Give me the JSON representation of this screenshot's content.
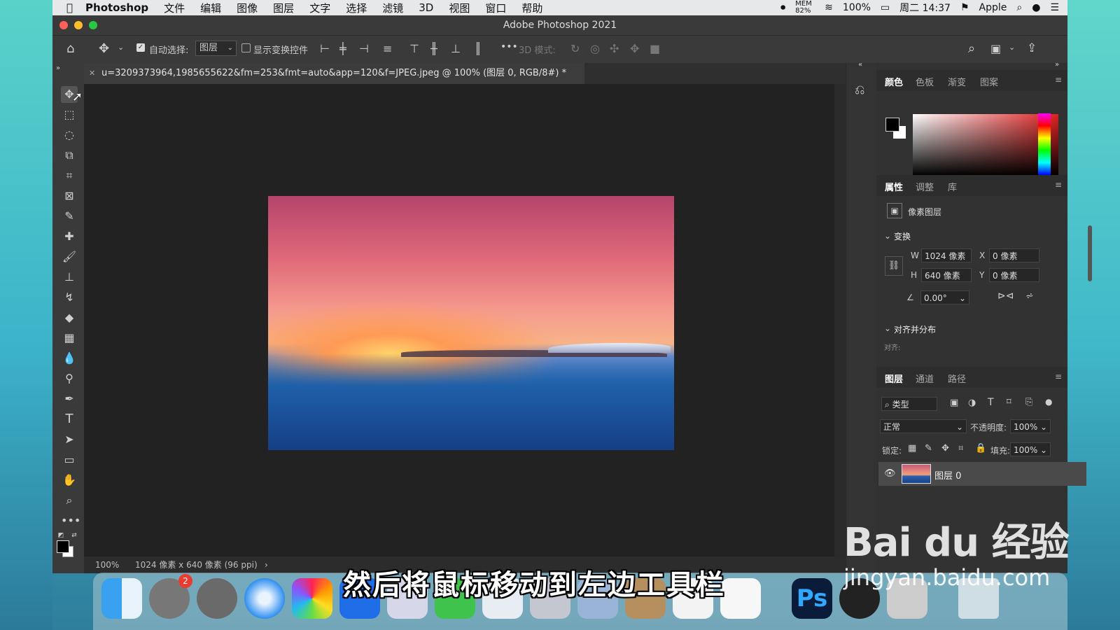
{
  "menubar": {
    "app_name": "Photoshop",
    "items": [
      "文件",
      "编辑",
      "图像",
      "图层",
      "文字",
      "选择",
      "滤镜",
      "3D",
      "视图",
      "窗口",
      "帮助"
    ],
    "mem": "MEM 82%",
    "battery": "100%",
    "clock": "周二 14:37",
    "user": "Apple"
  },
  "window": {
    "title": "Adobe Photoshop 2021"
  },
  "options_bar": {
    "auto_select_label": "自动选择:",
    "auto_select_value": "图层",
    "show_transform_label": "显示变换控件",
    "mode_3d_label": "3D 模式:",
    "more_label": "•••"
  },
  "document": {
    "tab_title": "u=3209373964,1985655622&fm=253&fmt=auto&app=120&f=JPEG.jpeg @ 100% (图层 0, RGB/8#) *",
    "zoom": "100%",
    "dimensions": "1024 像素 x 640 像素 (96 ppi)"
  },
  "color_panel": {
    "tabs": [
      "颜色",
      "色板",
      "渐变",
      "图案"
    ],
    "active": "颜色"
  },
  "properties_panel": {
    "tabs": [
      "属性",
      "调整",
      "库"
    ],
    "layer_type": "像素图层",
    "transform_header": "变换",
    "w_label": "W",
    "w_value": "1024 像素",
    "h_label": "H",
    "h_value": "640 像素",
    "x_label": "X",
    "x_value": "0 像素",
    "y_label": "Y",
    "y_value": "0 像素",
    "angle_value": "0.00°",
    "align_header": "对齐并分布",
    "align_sub": "对齐:"
  },
  "layers_panel": {
    "tabs": [
      "图层",
      "通道",
      "路径"
    ],
    "filter_label": "类型",
    "blend_mode": "正常",
    "opacity_label": "不透明度:",
    "opacity_value": "100%",
    "lock_label": "锁定:",
    "fill_label": "填充:",
    "fill_value": "100%",
    "layers": [
      {
        "name": "图层 0"
      }
    ]
  },
  "dock": {
    "badge_count": "2",
    "ps_label": "Ps"
  },
  "caption": "然后将鼠标移动到左边工具栏",
  "watermark": {
    "line1": "Bai du 经验",
    "line2": "jingyan.baidu.com"
  }
}
